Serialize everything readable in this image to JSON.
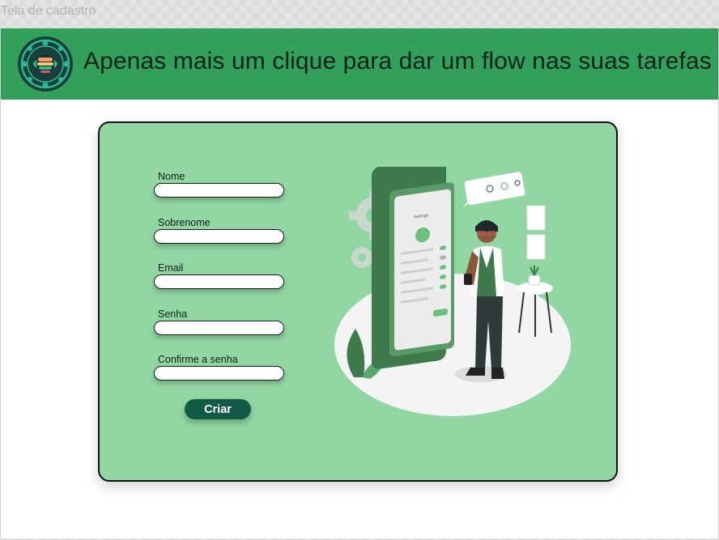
{
  "window": {
    "frame_label": "Tela de cadastro"
  },
  "header": {
    "title": "Apenas mais um clique para dar um flow nas suas tarefas",
    "background": "#32a05a",
    "logo_icon": "mandala-logo-icon"
  },
  "form": {
    "fields": [
      {
        "label": "Nome",
        "value": ""
      },
      {
        "label": "Sobrenome",
        "value": ""
      },
      {
        "label": "Email",
        "value": ""
      },
      {
        "label": "Senha",
        "value": ""
      },
      {
        "label": "Confirme a senha",
        "value": ""
      }
    ],
    "submit_label": "Criar"
  },
  "colors": {
    "card": "#91d6a3",
    "button": "#135a45",
    "phone": "#3e7a4c"
  },
  "illustration": {
    "icon": "person-phone-login-illustration"
  }
}
